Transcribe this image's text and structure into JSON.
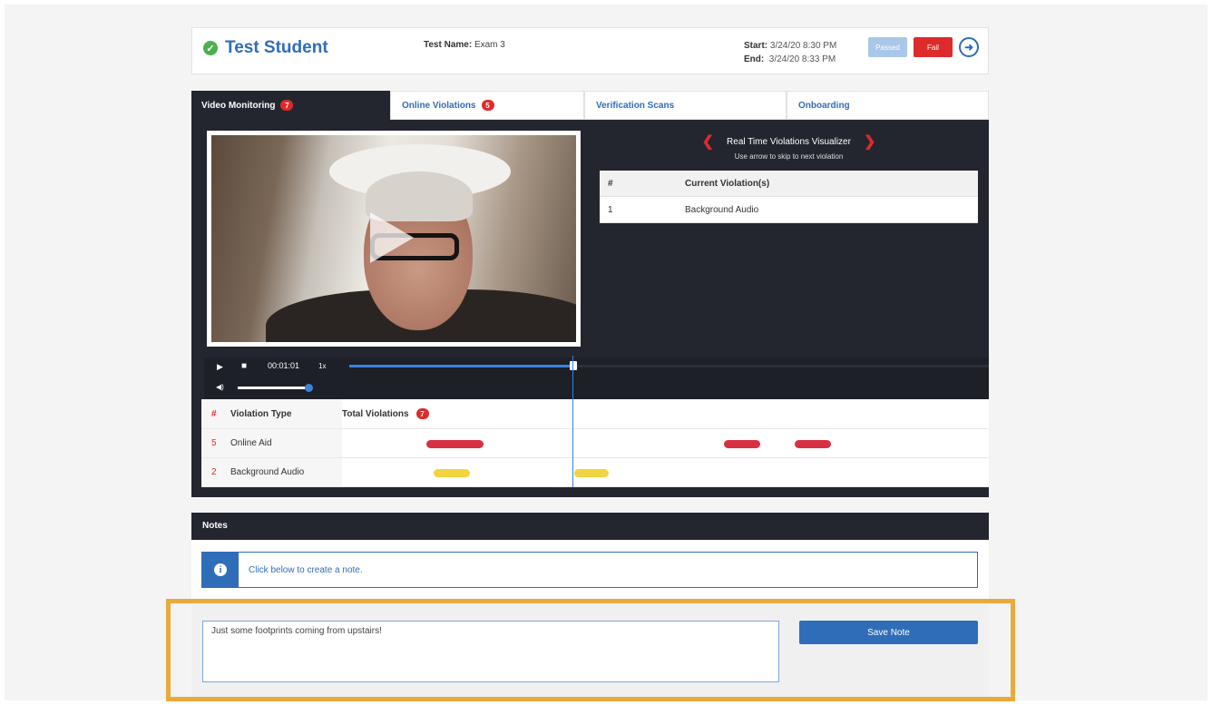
{
  "header": {
    "student_name": "Test Student",
    "test_name_label": "Test Name:",
    "test_name": "Exam 3",
    "start_label": "Start:",
    "start": "3/24/20 8:30 PM",
    "end_label": "End:",
    "end": "3/24/20 8:33 PM",
    "passed_label": "Passed",
    "fail_label": "Fail"
  },
  "tabs": [
    {
      "label": "Video Monitoring",
      "badge": "7"
    },
    {
      "label": "Online Violations",
      "badge": "5"
    },
    {
      "label": "Verification Scans"
    },
    {
      "label": "Onboarding"
    }
  ],
  "visualizer": {
    "title": "Real Time Violations Visualizer",
    "subtitle": "Use arrow to skip to next violation",
    "table_headers": [
      "#",
      "Current Violation(s)"
    ],
    "rows": [
      {
        "num": "1",
        "violation": "Background Audio"
      }
    ]
  },
  "player": {
    "time": "00:01:01",
    "speed": "1x",
    "progress": 0.35,
    "volume": 0.95
  },
  "violations": {
    "headers": {
      "num": "#",
      "type": "Violation Type",
      "total": "Total Violations"
    },
    "total_badge": "7",
    "rows": [
      {
        "count": "5",
        "type": "Online Aid"
      },
      {
        "count": "2",
        "type": "Background Audio"
      }
    ]
  },
  "notes": {
    "title": "Notes",
    "info": "Click below to create a note.",
    "input_value": "Just some footprints coming from upstairs!",
    "save_label": "Save Note"
  },
  "colors": {
    "accent": "#2f6db8",
    "danger": "#dd2b2b",
    "warning": "#f1d43f",
    "dark": "#23262e",
    "highlight": "#e9aa3c"
  }
}
